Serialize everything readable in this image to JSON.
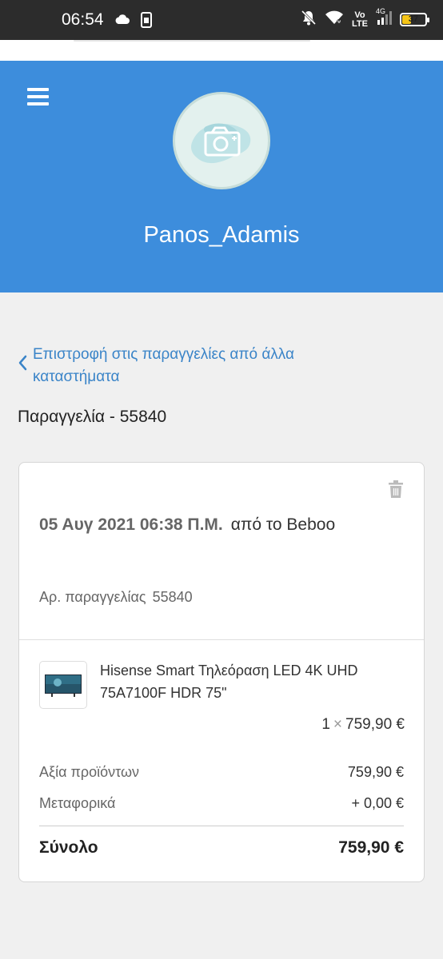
{
  "status": {
    "time": "06:54",
    "network_top": "4G",
    "volte_line1": "Vo",
    "volte_line2": "LTE",
    "battery": "37"
  },
  "header": {
    "username": "Panos_Adamis",
    "color": "#3d8ddc"
  },
  "back_link": {
    "label": "Επιστροφή στις παραγγελίες από άλλα καταστήματα"
  },
  "order_title": "Παραγγελία - 55840",
  "order": {
    "date": "05 Αυγ 2021 06:38 Π.Μ.",
    "from_label": "από το Beboo",
    "number_label": "Αρ. παραγγελίας",
    "number": "55840",
    "item": {
      "name": "Hisense Smart Τηλεόραση LED 4K UHD 75A7100F HDR 75\"",
      "quantity": "1",
      "times": "×",
      "price": "759,90 €"
    },
    "summary": {
      "products_label": "Αξία προϊόντων",
      "products_value": "759,90 €",
      "shipping_label": "Μεταφορικά",
      "shipping_value": "+ 0,00 €",
      "total_label": "Σύνολο",
      "total_value": "759,90 €"
    }
  },
  "icons": [
    "menu-icon",
    "camera-icon",
    "chevron-left-icon",
    "trash-icon",
    "cloud-icon",
    "sim-icon",
    "mute-icon",
    "wifi-icon",
    "signal-icon",
    "battery-icon"
  ]
}
